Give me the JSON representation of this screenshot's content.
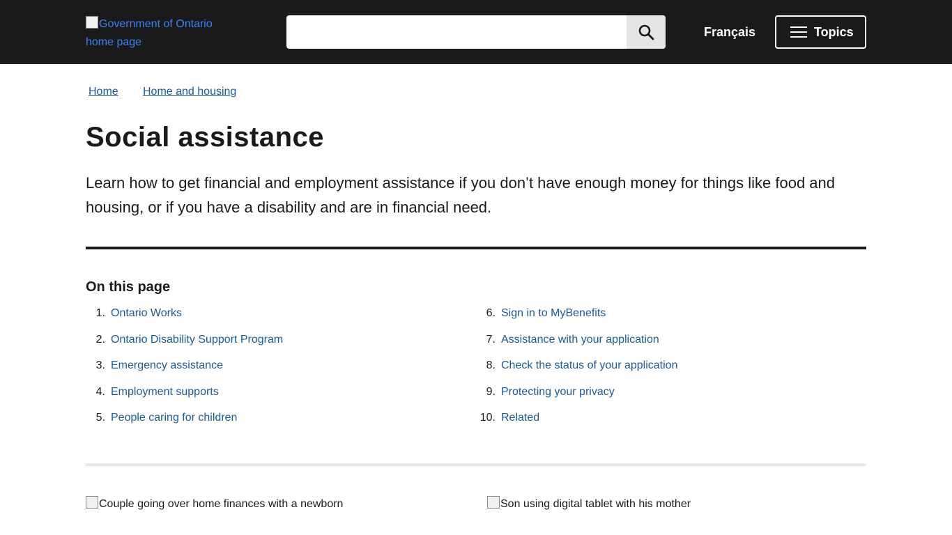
{
  "header": {
    "logo_alt": "Government of Ontario home page",
    "search": {
      "value": "",
      "placeholder": ""
    },
    "language_link": "Français",
    "topics_label": "Topics"
  },
  "breadcrumb": [
    "Home",
    "Home and housing"
  ],
  "page": {
    "title": "Social assistance",
    "lead": "Learn how to get financial and employment assistance if you don’t have enough money for things like food and housing, or if you have a disability and are in financial need."
  },
  "on_this_page": {
    "heading": "On this page",
    "items": [
      {
        "num": "1.",
        "label": "Ontario Works"
      },
      {
        "num": "2.",
        "label": "Ontario Disability Support Program"
      },
      {
        "num": "3.",
        "label": "Emergency assistance"
      },
      {
        "num": "4.",
        "label": "Employment supports"
      },
      {
        "num": "5.",
        "label": "People caring for children"
      },
      {
        "num": "6.",
        "label": "Sign in to MyBenefits"
      },
      {
        "num": "7.",
        "label": "Assistance with your application"
      },
      {
        "num": "8.",
        "label": "Check the status of your application"
      },
      {
        "num": "9.",
        "label": "Protecting your privacy"
      },
      {
        "num": "10.",
        "label": "Related"
      }
    ]
  },
  "images": [
    {
      "alt": "Couple going over home finances with a newborn"
    },
    {
      "alt": "Son using digital tablet with his mother"
    }
  ],
  "colors": {
    "header_bg": "#1a1a1a",
    "link": "#1a5a96",
    "text": "#1a1a1a"
  },
  "icons": {
    "search": "search-icon",
    "menu": "menu-icon"
  }
}
